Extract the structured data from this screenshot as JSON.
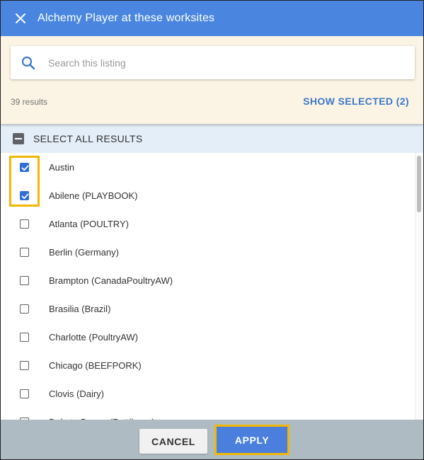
{
  "header": {
    "title": "Alchemy Player at these worksites",
    "close_icon": "close-icon"
  },
  "search": {
    "placeholder": "Search this listing",
    "value": ""
  },
  "results": {
    "count_label": "39 results",
    "show_selected_label": "SHOW SELECTED (2)"
  },
  "select_all": {
    "label": "SELECT ALL RESULTS",
    "state": "indeterminate"
  },
  "items": [
    {
      "label": "Austin",
      "checked": true
    },
    {
      "label": "Abilene (PLAYBOOK)",
      "checked": true
    },
    {
      "label": "Atlanta (POULTRY)",
      "checked": false
    },
    {
      "label": "Berlin (Germany)",
      "checked": false
    },
    {
      "label": "Brampton (CanadaPoultryAW)",
      "checked": false
    },
    {
      "label": "Brasilia (Brazil)",
      "checked": false
    },
    {
      "label": "Charlotte (PoultryAW)",
      "checked": false
    },
    {
      "label": "Chicago (BEEFPORK)",
      "checked": false
    },
    {
      "label": "Clovis (Dairy)",
      "checked": false
    },
    {
      "label": "Dakota Dunes (Pettibone)",
      "checked": false
    }
  ],
  "footer": {
    "cancel_label": "CANCEL",
    "apply_label": "APPLY"
  },
  "colors": {
    "header_bg": "#4a86e0",
    "accent": "#3a78c8",
    "highlight": "#f2b705",
    "panel_bg": "#fbf3e4",
    "footer_bg": "#aebbc2"
  }
}
